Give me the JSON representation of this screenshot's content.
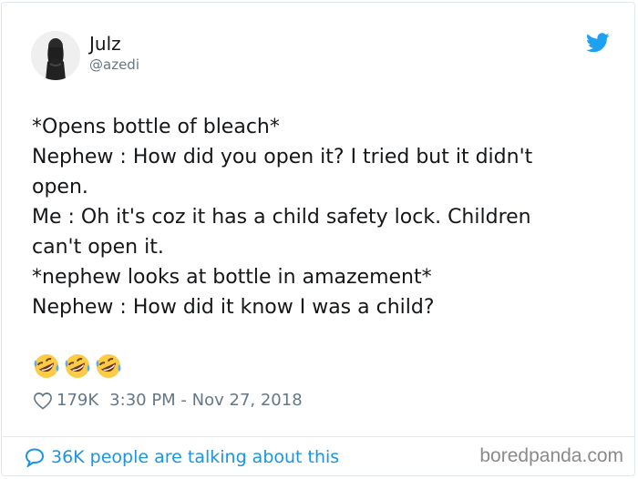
{
  "author": {
    "name": "Julz",
    "handle": "@azedi"
  },
  "tweet": {
    "lines": [
      "*Opens bottle of bleach*",
      "Nephew : How did you open it? I tried but it didn't",
      "open.",
      "Me : Oh it's coz it has a child safety lock. Children",
      "can't open it.",
      "*nephew looks at bottle in amazement*",
      "Nephew : How did it know I was a child?"
    ],
    "emojis": [
      "rolling-on-floor-laughing-emoji",
      "rolling-on-floor-laughing-emoji",
      "rolling-on-floor-laughing-emoji"
    ]
  },
  "meta": {
    "likes": "179K",
    "timestamp": "3:30 PM - Nov 27, 2018"
  },
  "footer": {
    "talking": "36K people are talking about this",
    "watermark": "boredpanda.com"
  },
  "colors": {
    "twitter_blue": "#1da1f2",
    "link_blue": "#1b95e0",
    "text": "#14171a",
    "muted": "#657786"
  }
}
